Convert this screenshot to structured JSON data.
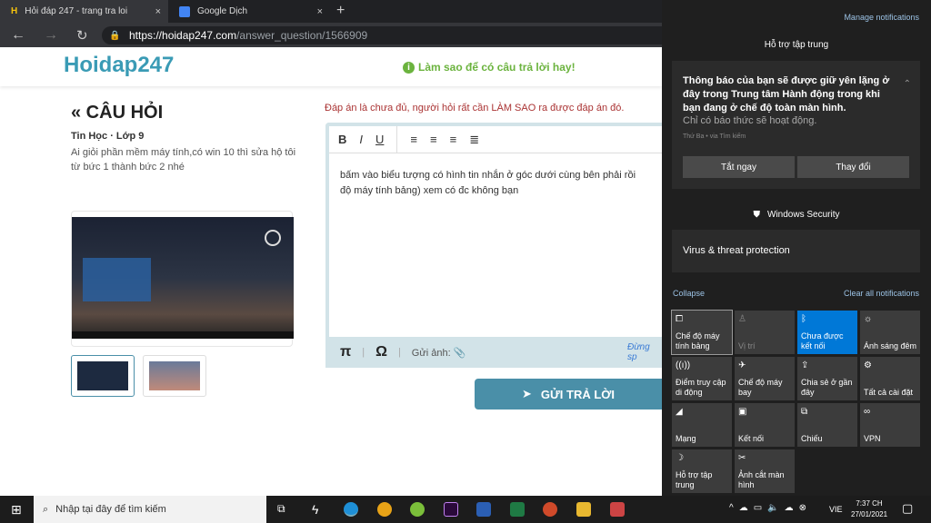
{
  "browser": {
    "tabs": [
      {
        "title": "Hỏi đáp 247 - trang tra loi",
        "close": "×"
      },
      {
        "title": "Google Dịch",
        "close": "×"
      }
    ],
    "new_tab": "+",
    "url_host": "https://hoidap247.com",
    "url_path": "/answer_question/1566909"
  },
  "site": {
    "logo": "Hoidap247",
    "tip": "Làm sao để có câu trả lời hay!"
  },
  "question": {
    "title": "« CÂU HỎI",
    "subject": "Tin Học · Lớp 9",
    "text_line1": "Ai giỏi phần mềm máy tính,có win 10 thì sửa hộ tôi",
    "text_line2": "từ bức 1 thành bức 2 nhé"
  },
  "answer": {
    "warning": "Đáp án là chưa đủ, người hỏi rất cần LÀM SAO ra được đáp án đó.",
    "toolbar": [
      "B",
      "I",
      "U"
    ],
    "content_line1": "bấm vào biểu tượng có hình tin nhắn ở góc dưới cùng bên phải rồi",
    "content_line2": "độ máy tính bảng) xem có đc không bạn",
    "pi": "π",
    "omega": "Ω",
    "attach_label": "Gửi ảnh:",
    "note": "Đừng sp",
    "send": "GỬI TRẢ LỜI"
  },
  "action_center": {
    "manage": "Manage notifications",
    "focus_header": "Hỗ trợ tập trung",
    "notif_title": "Thông báo của bạn sẽ được giữ yên lặng ở đây trong Trung tâm Hành động trong khi bạn đang ở chế độ toàn màn hình.",
    "notif_body": "Chỉ có báo thức sẽ hoạt động.",
    "notif_meta": "Thứ Ba • via Tìm kiếm",
    "btn_off": "Tắt ngay",
    "btn_change": "Thay đổi",
    "security_header": "Windows Security",
    "security_item": "Virus & threat protection",
    "collapse": "Collapse",
    "clear": "Clear all notifications",
    "accent": "#0078d7",
    "tiles": [
      {
        "label": "Chế độ máy tính bảng",
        "icon": "tablet-icon"
      },
      {
        "label": "Vị trí",
        "icon": "location-icon"
      },
      {
        "label": "Chưa được kết nối",
        "icon": "bluetooth-icon",
        "active": true
      },
      {
        "label": "Ánh sáng đêm",
        "icon": "night-light-icon"
      },
      {
        "label": "Điểm truy cập di động",
        "icon": "hotspot-icon"
      },
      {
        "label": "Chế độ máy bay",
        "icon": "airplane-icon"
      },
      {
        "label": "Chia sẻ ở gần đây",
        "icon": "share-icon"
      },
      {
        "label": "Tất cả cài đặt",
        "icon": "settings-icon"
      },
      {
        "label": "Mạng",
        "icon": "network-icon"
      },
      {
        "label": "Kết nối",
        "icon": "connect-icon"
      },
      {
        "label": "Chiếu",
        "icon": "project-icon"
      },
      {
        "label": "VPN",
        "icon": "vpn-icon"
      },
      {
        "label": "Hỗ trợ tập trung",
        "icon": "moon-icon"
      },
      {
        "label": "Ảnh cắt màn hình",
        "icon": "snip-icon"
      }
    ]
  },
  "taskbar": {
    "search_placeholder": "Nhập tại đây để tìm kiếm",
    "lang": "VIE",
    "time": "7:37 CH",
    "date": "27/01/2021"
  }
}
